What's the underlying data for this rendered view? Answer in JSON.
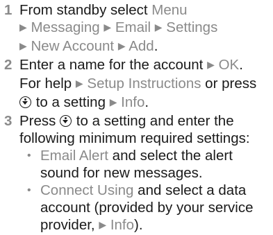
{
  "steps": [
    {
      "num": "1",
      "line1_pre": "From standby select ",
      "menu": "Menu",
      "messaging": "Messaging",
      "email": "Email",
      "settings": "Settings",
      "new_account": "New Account",
      "add": "Add",
      "end": "."
    },
    {
      "num": "2",
      "line1_pre": "Enter a name for the account ",
      "ok": "OK",
      "ok_end": ".",
      "help_pre": "For help ",
      "setup": "Setup Instructions",
      "help_post": " or press",
      "to_setting": " to a setting ",
      "info": "Info",
      "end": "."
    },
    {
      "num": "3",
      "press": "Press ",
      "line1_post": " to a setting and enter the",
      "line2": "following minimum required settings:",
      "bullets": [
        {
          "term": "Email Alert",
          "text1": " and select the alert",
          "text2": "sound for new messages."
        },
        {
          "term": "Connect Using",
          "text1": " and select a data",
          "text2": "account (provided by your service",
          "text3_pre": "provider, ",
          "info": "Info",
          "text3_post": ")."
        }
      ]
    }
  ],
  "icons": {
    "arrow": "▶",
    "bullet": "•",
    "navkey": "navigation-key-down-icon"
  }
}
